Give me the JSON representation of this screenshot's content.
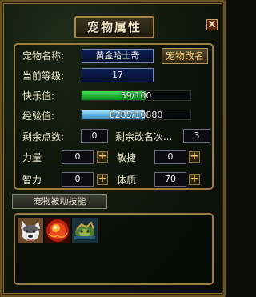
{
  "window": {
    "title": "宠物属性",
    "close_label": "X"
  },
  "pet": {
    "name_label": "宠物名称:",
    "name_value": "黄金哈士奇",
    "rename_button": "宠物改名",
    "level_label": "当前等级:",
    "level_value": "17",
    "happiness_label": "快乐值:",
    "happiness_text": "59/100",
    "happiness_ratio": 0.59,
    "exp_label": "经验值:",
    "exp_text": "6285/10880",
    "exp_ratio": 0.578,
    "points_label": "剩余点数:",
    "points_value": "0",
    "rename_count_label": "剩余改名次...",
    "rename_count_value": "3"
  },
  "stats": [
    {
      "label": "力量",
      "value": "0"
    },
    {
      "label": "敏捷",
      "value": "0"
    },
    {
      "label": "智力",
      "value": "0"
    },
    {
      "label": "体质",
      "value": "70"
    }
  ],
  "skills": {
    "tab_label": "宠物被动技能",
    "items": [
      {
        "icon": "husky-skill-icon"
      },
      {
        "icon": "fire-orb-skill-icon"
      },
      {
        "icon": "armored-beast-skill-icon"
      }
    ]
  },
  "colors": {
    "happiness_bar": "#19b52a",
    "exp_bar": "#3c9fd6",
    "frame_gold": "#9b7e3f"
  }
}
